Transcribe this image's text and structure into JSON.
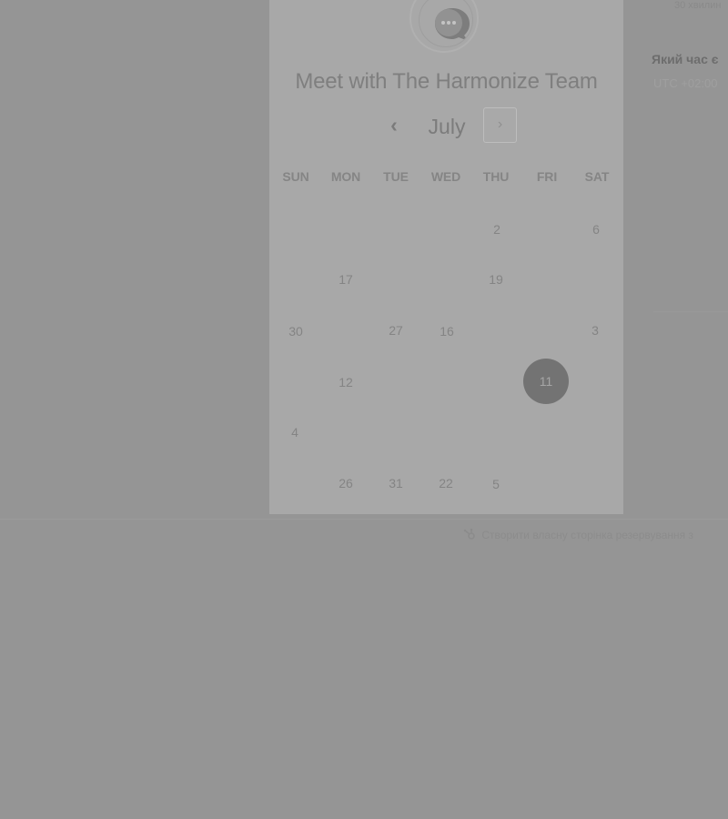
{
  "header": {
    "title": "Meet with The Harmonize Team"
  },
  "calendar": {
    "month_label": "July",
    "prev_icon": "chevron-left-icon",
    "next_icon": "chevron-right-icon",
    "weekdays": [
      "SUN",
      "MON",
      "TUE",
      "WED",
      "THU",
      "FRI",
      "SAT"
    ],
    "days": [
      {
        "label": "2",
        "selected": false
      },
      {
        "label": "6",
        "selected": false
      },
      {
        "label": "17",
        "selected": false
      },
      {
        "label": "19",
        "selected": false
      },
      {
        "label": "30",
        "selected": false
      },
      {
        "label": "27",
        "selected": false
      },
      {
        "label": "16",
        "selected": false
      },
      {
        "label": "3",
        "selected": false
      },
      {
        "label": "12",
        "selected": false
      },
      {
        "label": "11",
        "selected": true
      },
      {
        "label": "4",
        "selected": false
      },
      {
        "label": "26",
        "selected": false
      },
      {
        "label": "31",
        "selected": false
      },
      {
        "label": "22",
        "selected": false
      },
      {
        "label": "5",
        "selected": false
      }
    ]
  },
  "sidebar": {
    "duration_text": "30 хвилин",
    "question": "Який час є",
    "timezone_text": "UTC +02:00"
  },
  "footer": {
    "link_text": "Створити власну сторінка резервування з",
    "icon": "hubspot-sprocket-icon"
  },
  "colors": {
    "overlay": "#959595",
    "card": "#a8a8a8",
    "selected_day": "#737373"
  }
}
